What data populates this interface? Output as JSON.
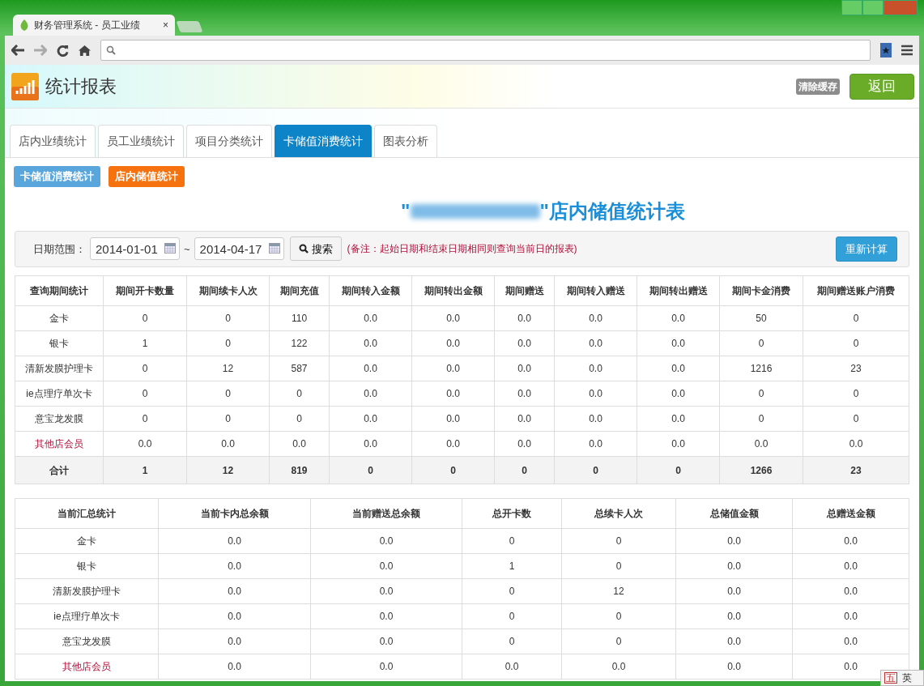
{
  "browser": {
    "tab_title": "财务管理系统 - 员工业绩",
    "tab_close": "×"
  },
  "header": {
    "title": "统计报表",
    "clear_cache": "清除缓存",
    "back": "返回"
  },
  "tabs": [
    {
      "label": "店内业绩统计",
      "selected": false
    },
    {
      "label": "员工业绩统计",
      "selected": false
    },
    {
      "label": "项目分类统计",
      "selected": false
    },
    {
      "label": "卡储值消费统计",
      "selected": true
    },
    {
      "label": "图表分析",
      "selected": false
    }
  ],
  "sub_buttons": [
    {
      "label": "卡储值消费统计",
      "kind": "info"
    },
    {
      "label": "店内储值统计",
      "kind": "warning"
    }
  ],
  "report_title": {
    "prefix": "\"",
    "suffix": "\"店内储值统计表"
  },
  "filter": {
    "label": "日期范围：",
    "start_date": "2014-01-01",
    "separator": "~",
    "end_date": "2014-04-17",
    "search": "搜索",
    "note": "(备注：起始日期和结束日期相同则查询当前日的报表)",
    "recalculate": "重新计算"
  },
  "period_table": {
    "columns": [
      "查询期间统计",
      "期间开卡数量",
      "期间续卡人次",
      "期间充值",
      "期间转入金额",
      "期间转出金额",
      "期间赠送",
      "期间转入赠送",
      "期间转出赠送",
      "期间卡金消费",
      "期间赠送账户消费"
    ],
    "rows": [
      {
        "highlight": false,
        "cells": [
          "金卡",
          "0",
          "0",
          "110",
          "0.0",
          "0.0",
          "0.0",
          "0.0",
          "0.0",
          "50",
          "0"
        ]
      },
      {
        "highlight": false,
        "cells": [
          "银卡",
          "1",
          "0",
          "122",
          "0.0",
          "0.0",
          "0.0",
          "0.0",
          "0.0",
          "0",
          "0"
        ]
      },
      {
        "highlight": false,
        "cells": [
          "清新发膜护理卡",
          "0",
          "12",
          "587",
          "0.0",
          "0.0",
          "0.0",
          "0.0",
          "0.0",
          "1216",
          "23"
        ]
      },
      {
        "highlight": false,
        "cells": [
          "ie点理疗单次卡",
          "0",
          "0",
          "0",
          "0.0",
          "0.0",
          "0.0",
          "0.0",
          "0.0",
          "0",
          "0"
        ]
      },
      {
        "highlight": false,
        "cells": [
          "意宝龙发膜",
          "0",
          "0",
          "0",
          "0.0",
          "0.0",
          "0.0",
          "0.0",
          "0.0",
          "0",
          "0"
        ]
      },
      {
        "highlight": true,
        "cells": [
          "其他店会员",
          "0.0",
          "0.0",
          "0.0",
          "0.0",
          "0.0",
          "0.0",
          "0.0",
          "0.0",
          "0.0",
          "0.0"
        ]
      }
    ],
    "total": [
      "合计",
      "1",
      "12",
      "819",
      "0",
      "0",
      "0",
      "0",
      "0",
      "1266",
      "23"
    ]
  },
  "summary_table": {
    "columns": [
      "当前汇总统计",
      "当前卡内总余额",
      "当前赠送总余额",
      "总开卡数",
      "总续卡人次",
      "总储值金额",
      "总赠送金额"
    ],
    "rows": [
      {
        "highlight": false,
        "cells": [
          "金卡",
          "0.0",
          "0.0",
          "0",
          "0",
          "0.0",
          "0.0"
        ]
      },
      {
        "highlight": false,
        "cells": [
          "银卡",
          "0.0",
          "0.0",
          "1",
          "0",
          "0.0",
          "0.0"
        ]
      },
      {
        "highlight": false,
        "cells": [
          "清新发膜护理卡",
          "0.0",
          "0.0",
          "0",
          "12",
          "0.0",
          "0.0"
        ]
      },
      {
        "highlight": false,
        "cells": [
          "ie点理疗单次卡",
          "0.0",
          "0.0",
          "0",
          "0",
          "0.0",
          "0.0"
        ]
      },
      {
        "highlight": false,
        "cells": [
          "意宝龙发膜",
          "0.0",
          "0.0",
          "0",
          "0",
          "0.0",
          "0.0"
        ]
      },
      {
        "highlight": true,
        "cells": [
          "其他店会员",
          "0.0",
          "0.0",
          "0.0",
          "0.0",
          "0.0",
          "0.0"
        ]
      }
    ]
  },
  "ime_bar": {
    "mode": "五",
    "language": "英"
  }
}
